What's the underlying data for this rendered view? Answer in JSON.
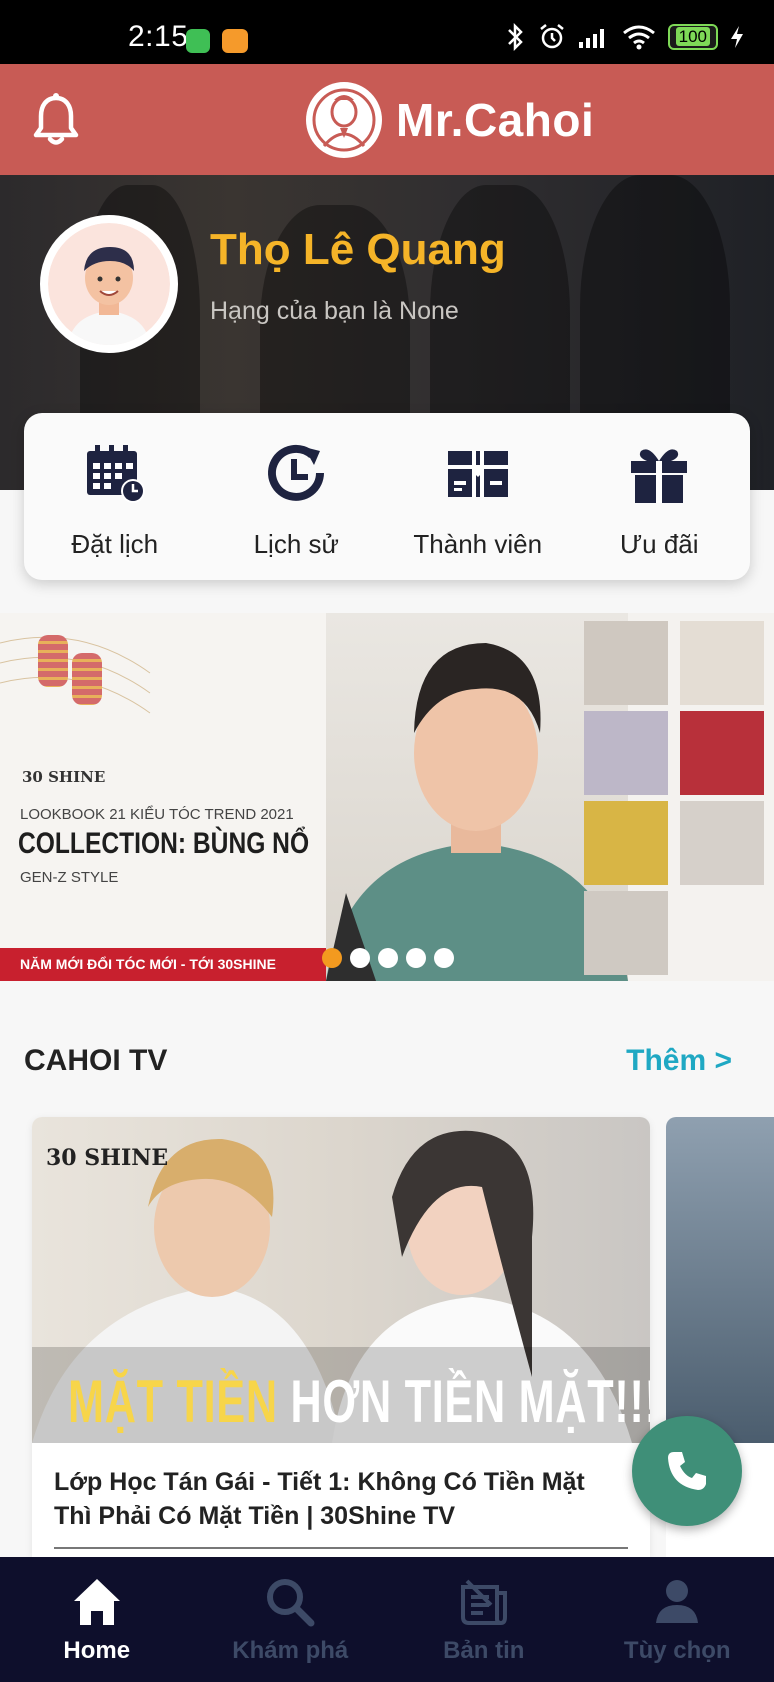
{
  "status_bar": {
    "time": "2:15",
    "battery": "100"
  },
  "header": {
    "app_name": "Mr.Cahoi"
  },
  "profile": {
    "name": "Thọ Lê Quang",
    "rank_text": "Hạng của bạn là None"
  },
  "actions": [
    {
      "label": "Đặt lịch",
      "icon": "calendar-clock-icon"
    },
    {
      "label": "Lịch sử",
      "icon": "history-icon"
    },
    {
      "label": "Thành viên",
      "icon": "member-card-icon"
    },
    {
      "label": "Ưu đãi",
      "icon": "gift-icon"
    }
  ],
  "banner": {
    "brand": "30 SHINE",
    "lookbook": "LOOKBOOK 21 KIỂU TÓC TREND 2021",
    "collection": "COLLECTION: BÙNG NỔ",
    "genz": "GEN-Z STYLE",
    "strip": "NĂM MỚI ĐỔI TÓC MỚI - TỚI 30SHINE",
    "slide_count": 5,
    "active_slide": 1
  },
  "section": {
    "title": "CAHOI TV",
    "more_label": "Thêm >"
  },
  "video": {
    "brand": "30 SHINE",
    "overlay_yellow": "MẶT TIỀN",
    "overlay_white": "HƠN TIỀN MẶT!!!",
    "title": "Lớp Học Tán Gái - Tiết 1: Không Có Tiền Mặt Thì Phải Có Mặt Tiền | 30Shine TV"
  },
  "bottom_nav": [
    {
      "label": "Home",
      "icon": "home-icon",
      "active": true
    },
    {
      "label": "Khám phá",
      "icon": "search-icon",
      "active": false
    },
    {
      "label": "Bản tin",
      "icon": "news-icon",
      "active": false
    },
    {
      "label": "Tùy chọn",
      "icon": "user-icon",
      "active": false
    }
  ],
  "colors": {
    "header": "#c85b55",
    "name": "#f5b428",
    "accent_link": "#1fa8c3",
    "fab": "#3f8f78",
    "nav_bg": "#0e0f2c"
  }
}
